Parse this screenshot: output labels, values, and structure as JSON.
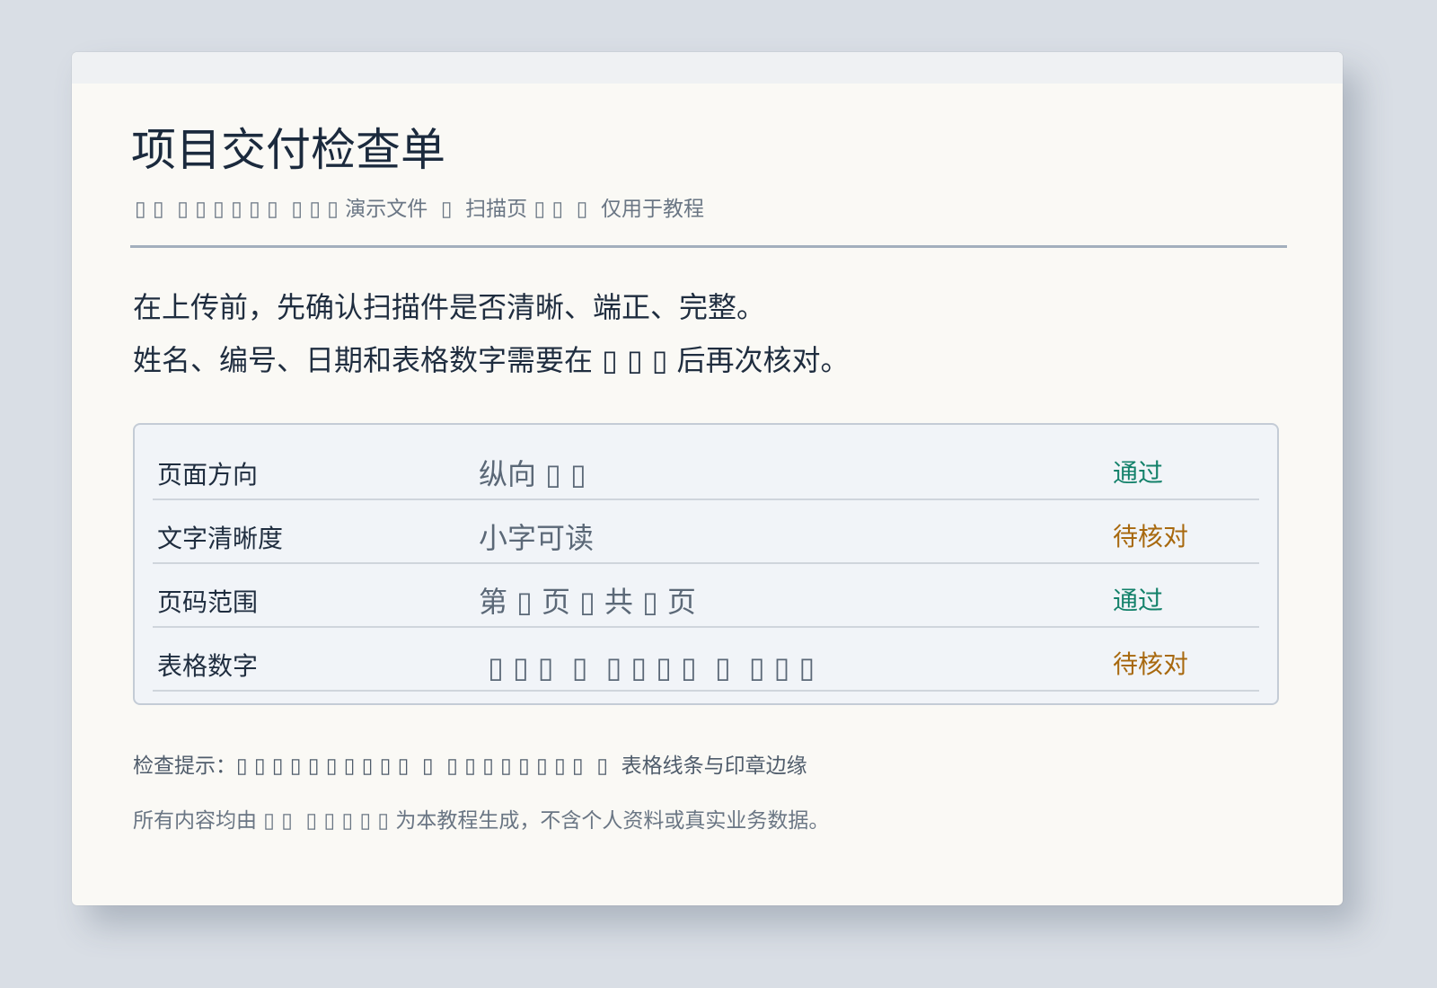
{
  "document": {
    "title": "项目交付检查单",
    "subtitle": "▯ ▯  ▯ ▯ ▯ ▯ ▯ ▯  ▯ ▯ ▯ 演示文件  ▯  扫描页 ▯ ▯  ▯  仅用于教程",
    "intro": [
      "在上传前，先确认扫描件是否清晰、端正、完整。",
      "姓名、编号、日期和表格数字需要在 ▯ ▯ ▯ 后再次核对。"
    ]
  },
  "checklist": [
    {
      "label": "页面方向",
      "value": "纵向 ▯ ▯",
      "status": "通过",
      "status_color": "#13816a"
    },
    {
      "label": "文字清晰度",
      "value": "小字可读",
      "status": "待核对",
      "status_color": "#a8690f"
    },
    {
      "label": "页码范围",
      "value": "第 ▯ 页 ▯ 共 ▯ 页",
      "status": "通过",
      "status_color": "#13816a"
    },
    {
      "label": "表格数字",
      "value": " ▯ ▯ ▯  ▯  ▯ ▯ ▯ ▯  ▯  ▯ ▯ ▯",
      "status": "待核对",
      "status_color": "#a8690f"
    }
  ],
  "notes": {
    "hint": "检查提示：▯ ▯ ▯ ▯ ▯ ▯ ▯ ▯ ▯ ▯  ▯  ▯ ▯ ▯ ▯ ▯ ▯ ▯ ▯  ▯  表格线条与印章边缘",
    "footer": "所有内容均由 ▯ ▯  ▯ ▯ ▯ ▯ ▯ 为本教程生成，不含个人资料或真实业务数据。"
  }
}
